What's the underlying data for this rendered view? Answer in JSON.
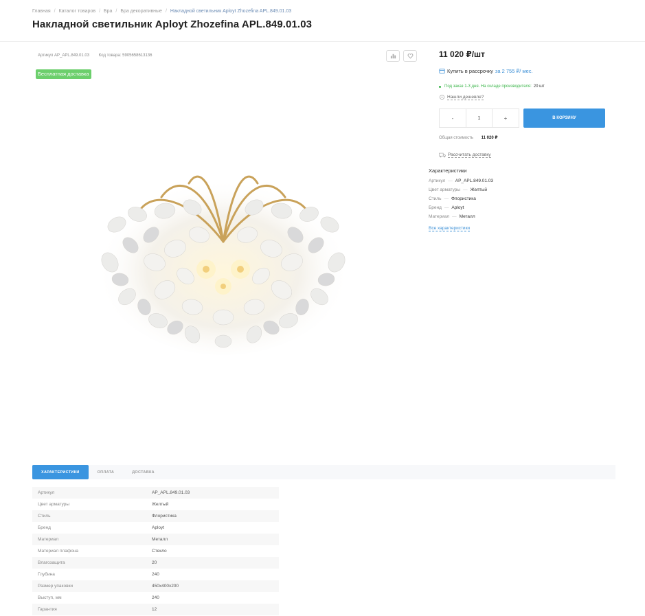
{
  "breadcrumbs": [
    "Главная",
    "Каталог товаров",
    "Бра",
    "Бра декоративные",
    "Накладной светильник Aployt Zhozefina APL.849.01.03"
  ],
  "title": "Накладной светильник Aployt Zhozefina APL.849.01.03",
  "meta": {
    "article": "Артикул AP_APL.849.01.03",
    "code": "Код товара: 5905658613136"
  },
  "badge": "Бесплатная доставка",
  "icons": {
    "compare": "compare-chart-icon",
    "favorite": "heart-icon",
    "installment": "card-icon",
    "cheaper": "tag-icon",
    "delivery": "truck-icon"
  },
  "price": "11 020 ₽/шт",
  "installment": {
    "label": "Купить в рассрочку",
    "link": "за 2 755 ₽/ мес."
  },
  "stock": {
    "text": "Под заказ 1-3 дня. На складе производителя:",
    "count": "20 шт"
  },
  "cheaper_link": "Нашли дешевле?",
  "quantity": {
    "minus": "-",
    "value": "1",
    "plus": "+"
  },
  "cart_button": "В корзину",
  "total": {
    "label": "Общая стоимость",
    "value": "11 020 ₽"
  },
  "delivery_link": "Рассчитать доставку",
  "specs_heading": "Характеристики",
  "short_specs": [
    {
      "k": "Артикул",
      "v": "AP_APL.849.01.03"
    },
    {
      "k": "Цвет арматуры",
      "v": "Желтый"
    },
    {
      "k": "Стиль",
      "v": "Флористика"
    },
    {
      "k": "Бренд",
      "v": "Aployt"
    },
    {
      "k": "Материал",
      "v": "Металл"
    }
  ],
  "all_specs_link": "Все характеристики",
  "tabs": [
    "Характеристики",
    "Оплата",
    "Доставка"
  ],
  "spec_table": [
    {
      "k": "Артикул",
      "v": "AP_APL.849.01.03"
    },
    {
      "k": "Цвет арматуры",
      "v": "Желтый"
    },
    {
      "k": "Стиль",
      "v": "Флористика"
    },
    {
      "k": "Бренд",
      "v": "Aployt"
    },
    {
      "k": "Материал",
      "v": "Металл"
    },
    {
      "k": "Материал плафона",
      "v": "Стекло"
    },
    {
      "k": "Влагозащита",
      "v": "20"
    },
    {
      "k": "Глубина",
      "v": "240"
    },
    {
      "k": "Размер упаковки",
      "v": "450x400x200"
    },
    {
      "k": "Выступ, мм",
      "v": "240"
    },
    {
      "k": "Гарантия",
      "v": "12"
    }
  ],
  "colors": {
    "accent": "#3a95e0",
    "badge_green": "#6ccf6c",
    "stock_green": "#3bb54a"
  }
}
